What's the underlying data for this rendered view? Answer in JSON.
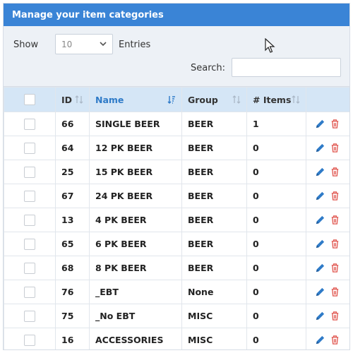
{
  "header": {
    "title": "Manage your item categories"
  },
  "toolbar": {
    "show_label": "Show",
    "page_size": "10",
    "entries_label": "Entries",
    "search_label": "Search:",
    "search_value": ""
  },
  "table": {
    "columns": [
      "ID",
      "Name",
      "Group",
      "# Items"
    ],
    "rows": [
      {
        "id": "66",
        "name": "SINGLE BEER",
        "group": "BEER",
        "items": "1"
      },
      {
        "id": "64",
        "name": "12 PK BEER",
        "group": "BEER",
        "items": "0"
      },
      {
        "id": "25",
        "name": "15 PK BEER",
        "group": "BEER",
        "items": "0"
      },
      {
        "id": "67",
        "name": "24 PK BEER",
        "group": "BEER",
        "items": "0"
      },
      {
        "id": "13",
        "name": "4 PK BEER",
        "group": "BEER",
        "items": "0"
      },
      {
        "id": "65",
        "name": "6 PK BEER",
        "group": "BEER",
        "items": "0"
      },
      {
        "id": "68",
        "name": "8 PK BEER",
        "group": "BEER",
        "items": "0"
      },
      {
        "id": "76",
        "name": "_EBT",
        "group": "None",
        "items": "0"
      },
      {
        "id": "75",
        "name": "_No EBT",
        "group": "MISC",
        "items": "0"
      },
      {
        "id": "16",
        "name": "ACCESSORIES",
        "group": "MISC",
        "items": "0"
      }
    ]
  },
  "colors": {
    "header_bg": "#3a84d6",
    "table_header_bg": "#d5e6f6",
    "sorted_column": "#2f7bc8",
    "edit_icon": "#2f7bc8",
    "delete_icon": "#e0564f"
  },
  "icons": {
    "edit": "pencil-icon",
    "delete": "trash-icon",
    "sort": "sort-icon",
    "dropdown": "chevron-down-icon"
  }
}
